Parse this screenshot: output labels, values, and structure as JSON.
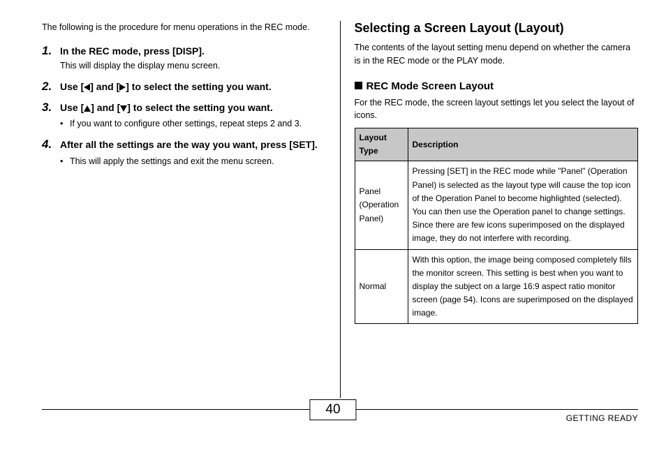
{
  "left": {
    "intro": "The following is the procedure for menu operations in the REC mode.",
    "steps": [
      {
        "num": "1.",
        "title": "In the REC mode, press [DISP].",
        "sub": "This will display the display menu screen."
      },
      {
        "num": "2.",
        "title_pre": "Use [",
        "title_mid": "] and [",
        "title_post": "] to select the setting you want."
      },
      {
        "num": "3.",
        "title_pre": "Use [",
        "title_mid": "] and [",
        "title_post": "] to select the setting you want.",
        "bullet": "If you want to configure other settings, repeat steps 2 and 3."
      },
      {
        "num": "4.",
        "title": "After all the settings are the way you want, press [SET].",
        "bullet": "This will apply the settings and exit the menu screen."
      }
    ]
  },
  "right": {
    "heading": "Selecting a Screen Layout (Layout)",
    "intro": "The contents of the layout setting menu depend on whether the camera is in the REC mode or the PLAY mode.",
    "subhead": "REC Mode Screen Layout",
    "subintro": "For the REC mode, the screen layout settings let you select the layout of icons.",
    "table": {
      "h1": "Layout Type",
      "h2": "Description",
      "rows": [
        {
          "type": "Panel (Operation Panel)",
          "desc": "Pressing [SET] in the REC mode while \"Panel\" (Operation Panel) is selected as the layout type will cause the top icon of the Operation Panel to become highlighted (selected). You can then use the Operation panel to change settings. Since there are few icons superimposed on the displayed image, they do not interfere with recording."
        },
        {
          "type": "Normal",
          "desc": "With this option, the image being composed completely fills the monitor screen. This setting is best when you want to display the subject on a large 16:9 aspect ratio monitor screen (page 54). Icons are superimposed on the displayed image."
        }
      ]
    }
  },
  "footer": {
    "page": "40",
    "label": "GETTING READY"
  }
}
